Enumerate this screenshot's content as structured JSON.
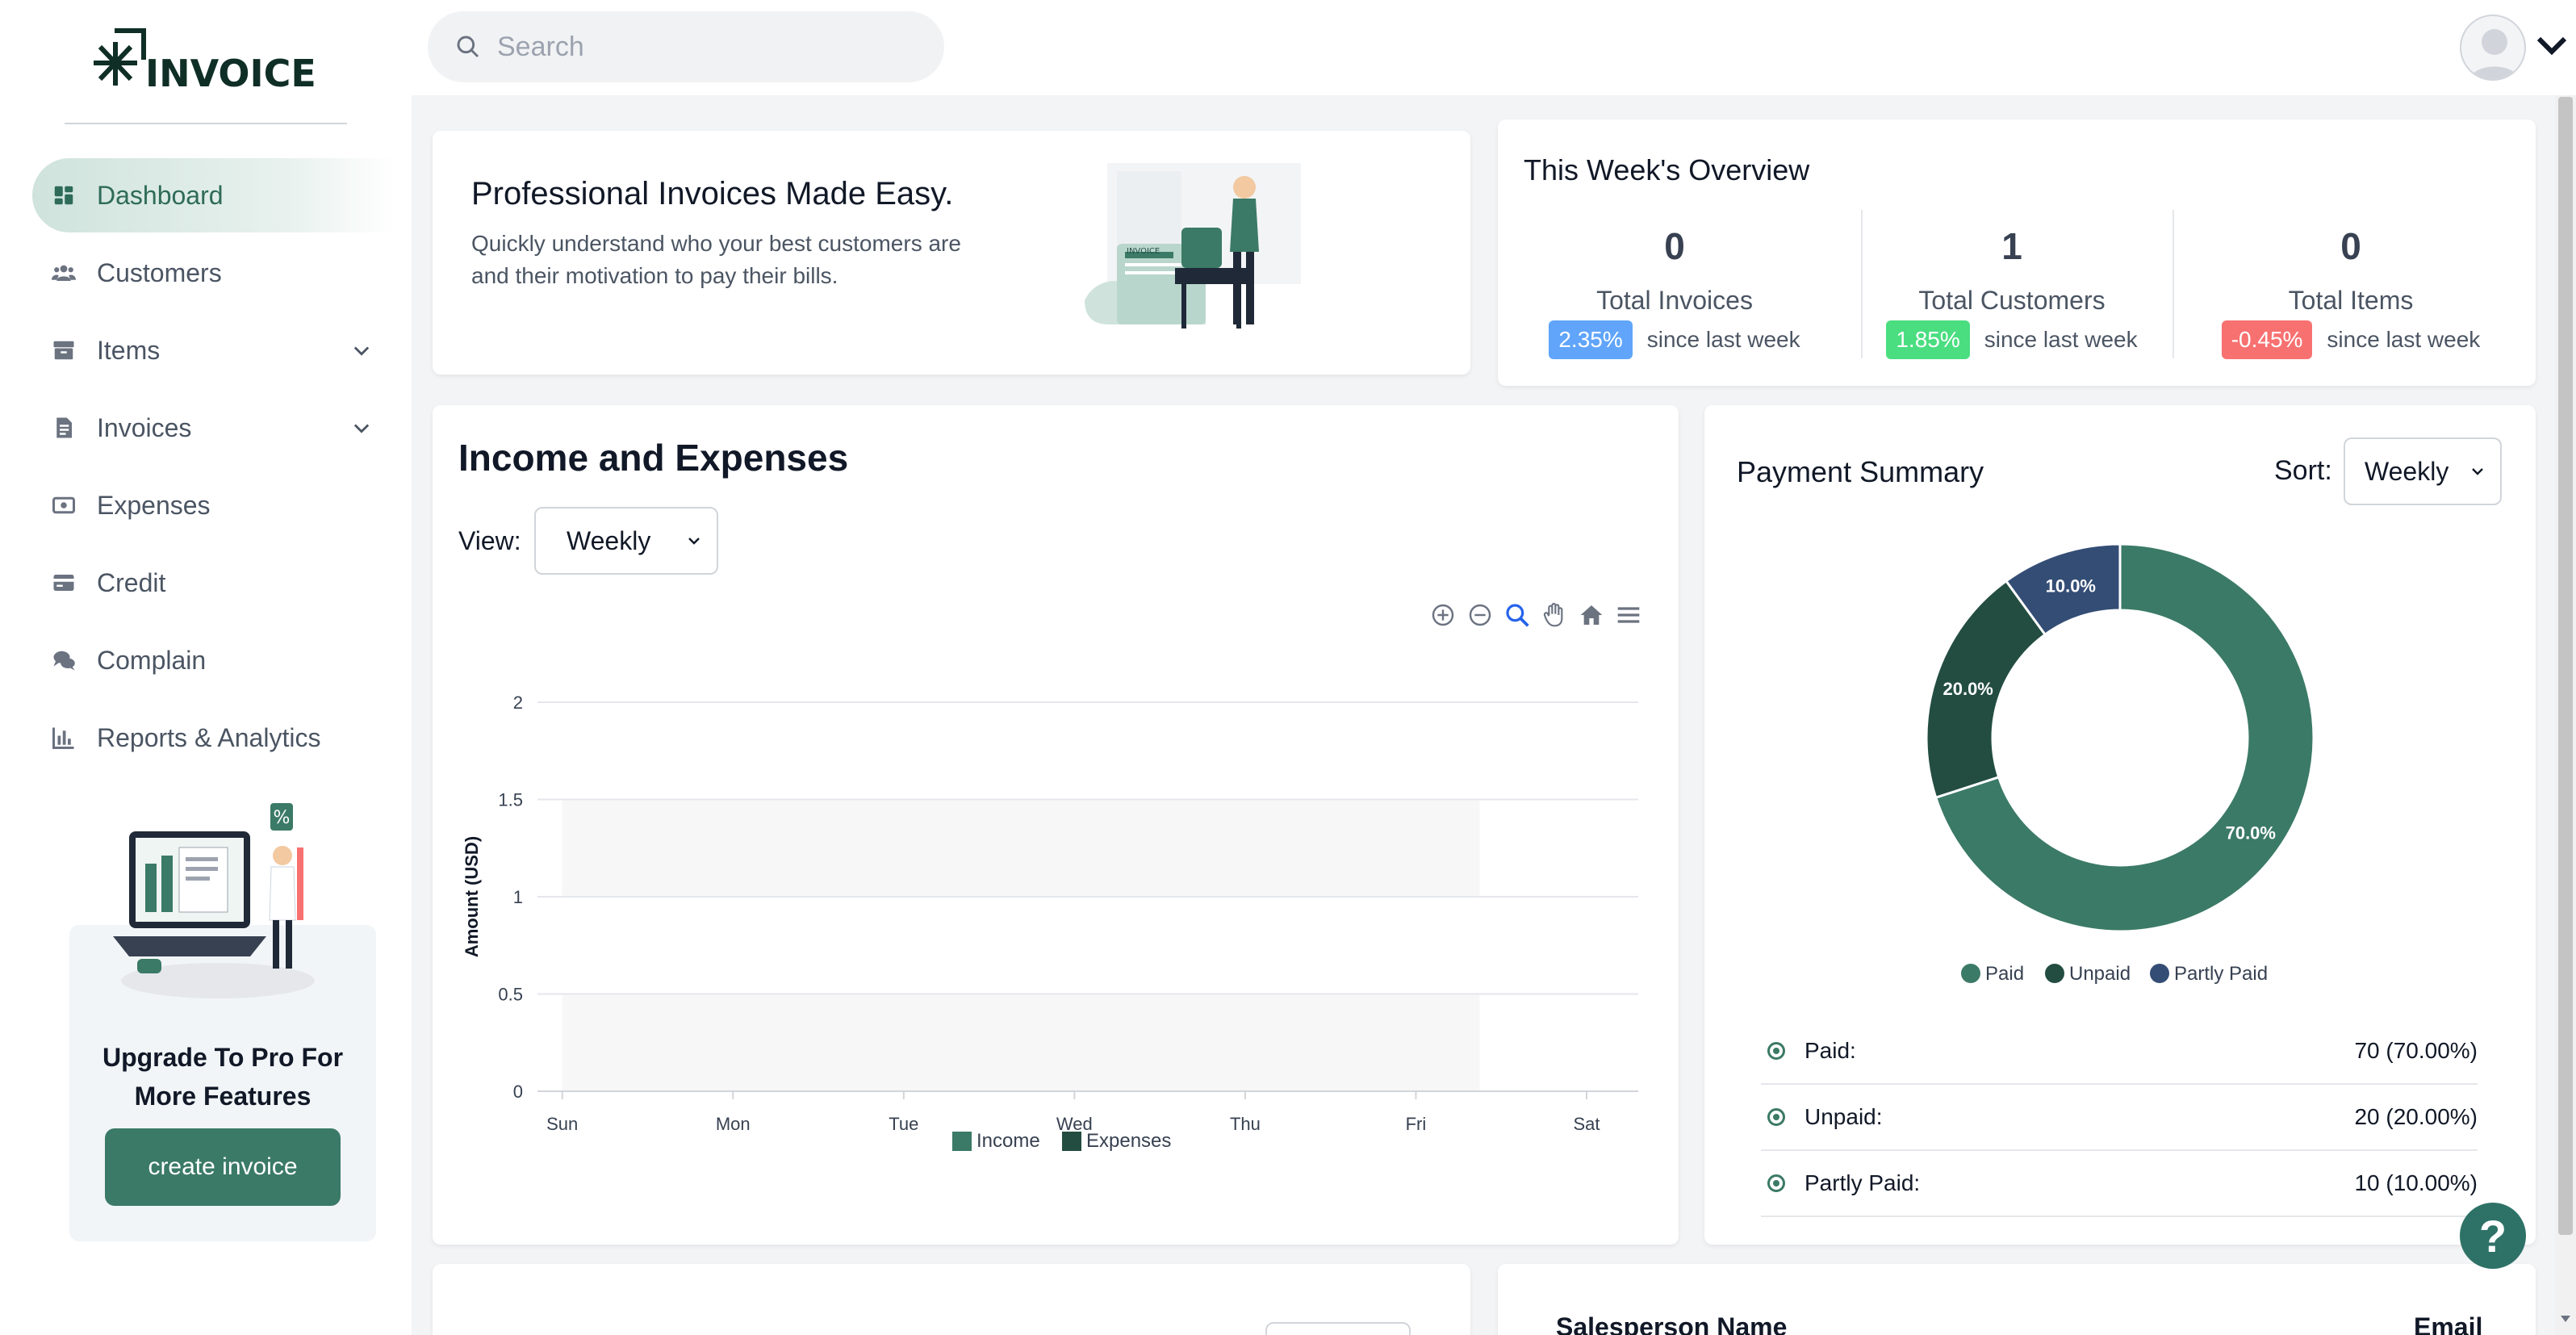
{
  "brand": {
    "logo_text": "INVOICE"
  },
  "sidebar": {
    "items": [
      {
        "label": "Dashboard",
        "icon": "dashboard-icon",
        "active": true
      },
      {
        "label": "Customers",
        "icon": "users-icon"
      },
      {
        "label": "Items",
        "icon": "box-icon",
        "expandable": true
      },
      {
        "label": "Invoices",
        "icon": "file-invoice-icon",
        "expandable": true
      },
      {
        "label": "Expenses",
        "icon": "money-bill-icon"
      },
      {
        "label": "Credit",
        "icon": "credit-card-icon"
      },
      {
        "label": "Complain",
        "icon": "comments-icon"
      },
      {
        "label": "Reports & Analytics",
        "icon": "chart-bar-icon"
      }
    ],
    "promo": {
      "title": "Upgrade To Pro For More Features",
      "button_label": "create invoice"
    }
  },
  "topbar": {
    "search_placeholder": "Search"
  },
  "hero": {
    "title": "Professional Invoices Made Easy.",
    "subtitle": "Quickly understand who your best customers are and their motivation to pay their bills."
  },
  "overview": {
    "title": "This Week's Overview",
    "stats": [
      {
        "value": "0",
        "label": "Total Invoices",
        "change": "2.35%",
        "since": "since last week",
        "color": "#60a5fa"
      },
      {
        "value": "1",
        "label": "Total Customers",
        "change": "1.85%",
        "since": "since last week",
        "color": "#4ade80"
      },
      {
        "value": "0",
        "label": "Total Items",
        "change": "-0.45%",
        "since": "since last week",
        "color": "#f87171"
      }
    ]
  },
  "income": {
    "title": "Income and Expenses",
    "view_label": "View:",
    "view_value": "Weekly"
  },
  "payment": {
    "title": "Payment Summary",
    "sort_label": "Sort:",
    "sort_value": "Weekly",
    "rows": [
      {
        "label": "Paid:",
        "value": "70 (70.00%)"
      },
      {
        "label": "Unpaid:",
        "value": "20 (20.00%)"
      },
      {
        "label": "Partly Paid:",
        "value": "10 (10.00%)"
      }
    ]
  },
  "bottom": {
    "col1": "Salesperson Name",
    "col2": "Email"
  },
  "help": {
    "label": "?"
  },
  "colors": {
    "accent": "#3b7a66",
    "paid": "#3b7a66",
    "unpaid": "#234d41",
    "partly": "#344d75"
  },
  "chart_data": [
    {
      "type": "bar",
      "categories": [
        "Sun",
        "Mon",
        "Tue",
        "Wed",
        "Thu",
        "Fri",
        "Sat"
      ],
      "series": [
        {
          "name": "Income",
          "values": [
            0,
            0,
            0,
            0,
            0,
            0,
            0
          ],
          "color": "#3b7a66"
        },
        {
          "name": "Expenses",
          "values": [
            0,
            0,
            0,
            0,
            0,
            0,
            0
          ],
          "color": "#234d41"
        }
      ],
      "ylabel": "Amount (USD)",
      "ylim": [
        0,
        2
      ],
      "yticks": [
        "0",
        "0.5",
        "1",
        "1.5",
        "2"
      ],
      "grid": true,
      "legend": "bottom"
    },
    {
      "type": "pie",
      "donut": true,
      "categories": [
        "Paid",
        "Unpaid",
        "Partly Paid"
      ],
      "values": [
        70,
        20,
        10
      ],
      "labels": [
        "70.0%",
        "20.0%",
        "10.0%"
      ],
      "colors": [
        "#3b7a66",
        "#234d41",
        "#344d75"
      ],
      "legend": "bottom"
    }
  ]
}
